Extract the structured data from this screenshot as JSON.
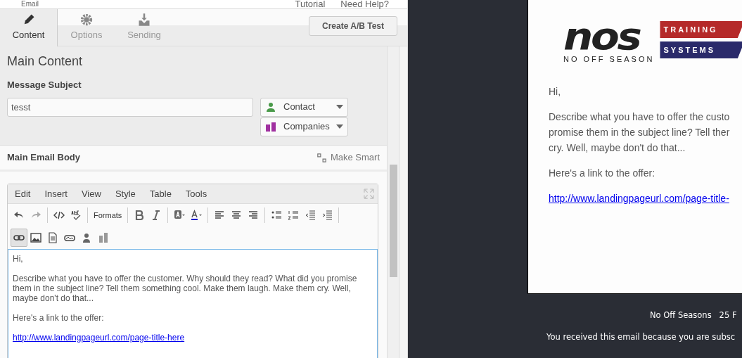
{
  "top_bar": {
    "section": "Email",
    "links": [
      "Tutorial",
      "Need Help?"
    ]
  },
  "tabs": [
    {
      "label": "Content",
      "selected": true
    },
    {
      "label": "Options",
      "selected": false
    },
    {
      "label": "Sending",
      "selected": false
    }
  ],
  "ab_button": "Create A/B Test",
  "main_content": {
    "title": "Main Content",
    "subject_label": "Message Subject",
    "subject_value": "tesst",
    "dropdowns": [
      "Contact",
      "Companies"
    ]
  },
  "body_section": {
    "title": "Main Email Body",
    "make_smart": "Make Smart"
  },
  "editor": {
    "menu": [
      "Edit",
      "Insert",
      "View",
      "Style",
      "Table",
      "Tools"
    ],
    "formats_label": "Formats",
    "link_pressed": true,
    "paragraphs": [
      "Hi,",
      "Describe what you have to offer the customer. Why should they read? What did you promise them in the subject line? Tell them something cool. Make them laugh. Make them cry. Well, maybe don't do that...",
      "Here's a link to the offer:"
    ],
    "link": "http://www.landingpageurl.com/page-title-here"
  },
  "preview": {
    "logo": {
      "word": "nos",
      "tagline": "NO OFF SEASON",
      "badges": [
        "TRAINING",
        "SYSTEMS"
      ]
    },
    "greeting": "Hi,",
    "body_lines": [
      "Describe what you have to offer the custo",
      "promise them in the subject line? Tell ther",
      "cry. Well, maybe don't do that..."
    ],
    "link_intro": "Here's a link to the offer:",
    "link": "http://www.landingpageurl.com/page-title-",
    "footer": [
      "No Off Seasons   25 F",
      "You received this email because you are subsc"
    ]
  }
}
